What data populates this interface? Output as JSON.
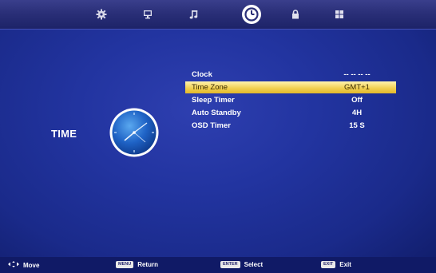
{
  "top_menu": {
    "items": [
      {
        "icon": "gear-icon",
        "label": "Picture"
      },
      {
        "icon": "monitor-icon",
        "label": "Screen"
      },
      {
        "icon": "music-note-icon",
        "label": "Sound"
      },
      {
        "icon": "clock-icon",
        "label": "Time",
        "active": true
      },
      {
        "icon": "lock-icon",
        "label": "Lock"
      },
      {
        "icon": "grid-icon",
        "label": "Setup"
      }
    ]
  },
  "page": {
    "title": "TIME",
    "icon": "analog-clock-icon"
  },
  "settings": [
    {
      "label": "Clock",
      "value": "-- --   -- --",
      "selected": false
    },
    {
      "label": "Time Zone",
      "value": "GMT+1",
      "selected": true
    },
    {
      "label": "Sleep Timer",
      "value": "Off",
      "selected": false
    },
    {
      "label": "Auto Standby",
      "value": "4H",
      "selected": false
    },
    {
      "label": "OSD Timer",
      "value": "15 S",
      "selected": false
    }
  ],
  "footer": {
    "move": {
      "icon": "move-arrows-icon",
      "label": "Move"
    },
    "return": {
      "key": "MENU",
      "label": "Return"
    },
    "select": {
      "key": "ENTER",
      "label": "Select"
    },
    "exit": {
      "key": "EXIT",
      "label": "Exit"
    }
  },
  "colors": {
    "background": "#2234a0",
    "highlight": "#f2d154",
    "highlight_text": "#3a2a00",
    "text": "#ffffff"
  }
}
